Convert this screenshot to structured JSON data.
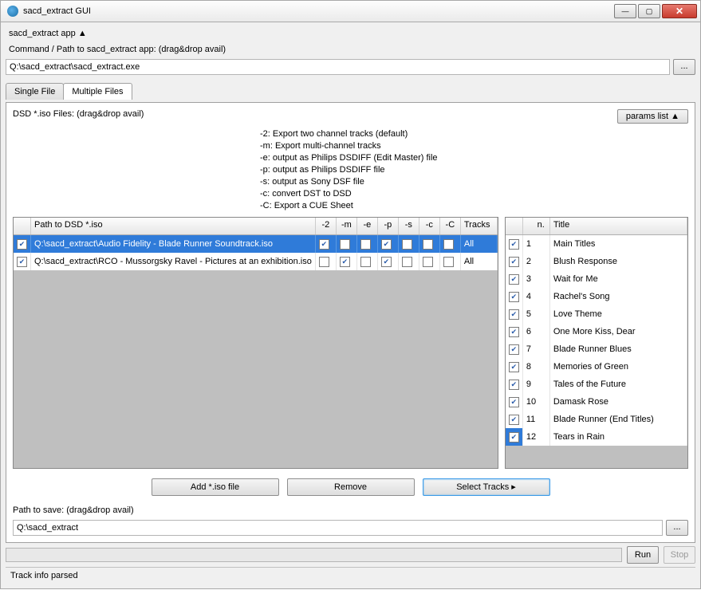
{
  "window": {
    "title": "sacd_extract GUI"
  },
  "header": {
    "app_label": "sacd_extract app ▲",
    "cmd_label": "Command / Path to sacd_extract app: (drag&drop avail)",
    "cmd_value": "Q:\\sacd_extract\\sacd_extract.exe"
  },
  "tabs": {
    "single": "Single File",
    "multiple": "Multiple Files"
  },
  "panel": {
    "dsd_label": "DSD *.iso Files: (drag&drop avail)",
    "params_btn": "params list ▲",
    "help": [
      "-2: Export two channel tracks (default)",
      "-m: Export multi-channel tracks",
      "-e: output as Philips DSDIFF (Edit Master) file",
      "-p: output as Philips DSDIFF file",
      "-s: output as Sony DSF file",
      "-c: convert DST to DSD",
      "-C: Export a CUE Sheet"
    ]
  },
  "iso_grid": {
    "headers": {
      "path": "Path to DSD *.iso",
      "f2": "-2",
      "fm": "-m",
      "fe": "-e",
      "fp": "-p",
      "fs": "-s",
      "fc": "-c",
      "fC": "-C",
      "tracks": "Tracks"
    },
    "rows": [
      {
        "checked": true,
        "selected": true,
        "path": "Q:\\sacd_extract\\Audio Fidelity - Blade Runner Soundtrack.iso",
        "f2": true,
        "fm": false,
        "fe": false,
        "fp": true,
        "fs": false,
        "fc": false,
        "fC": false,
        "tracks": "All"
      },
      {
        "checked": true,
        "selected": false,
        "path": "Q:\\sacd_extract\\RCO - Mussorgsky Ravel - Pictures at an exhibition.iso",
        "f2": false,
        "fm": true,
        "fe": false,
        "fp": true,
        "fs": false,
        "fc": false,
        "fC": false,
        "tracks": "All"
      }
    ]
  },
  "track_grid": {
    "headers": {
      "n": "n.",
      "title": "Title"
    },
    "rows": [
      {
        "checked": true,
        "n": "1",
        "title": "Main Titles"
      },
      {
        "checked": true,
        "n": "2",
        "title": "Blush Response"
      },
      {
        "checked": true,
        "n": "3",
        "title": "Wait for Me"
      },
      {
        "checked": true,
        "n": "4",
        "title": "Rachel's Song"
      },
      {
        "checked": true,
        "n": "5",
        "title": "Love Theme"
      },
      {
        "checked": true,
        "n": "6",
        "title": "One More Kiss, Dear"
      },
      {
        "checked": true,
        "n": "7",
        "title": "Blade Runner Blues"
      },
      {
        "checked": true,
        "n": "8",
        "title": "Memories of Green"
      },
      {
        "checked": true,
        "n": "9",
        "title": "Tales of the Future"
      },
      {
        "checked": true,
        "n": "10",
        "title": "Damask Rose"
      },
      {
        "checked": true,
        "n": "11",
        "title": "Blade Runner (End Titles)"
      },
      {
        "checked": true,
        "n": "12",
        "title": "Tears in Rain",
        "highlight": true
      }
    ]
  },
  "buttons": {
    "add": "Add *.iso file",
    "remove": "Remove",
    "select": "Select Tracks ▸"
  },
  "save": {
    "label": "Path to save: (drag&drop avail)",
    "value": "Q:\\sacd_extract"
  },
  "actions": {
    "run": "Run",
    "stop": "Stop"
  },
  "status": "Track info parsed"
}
